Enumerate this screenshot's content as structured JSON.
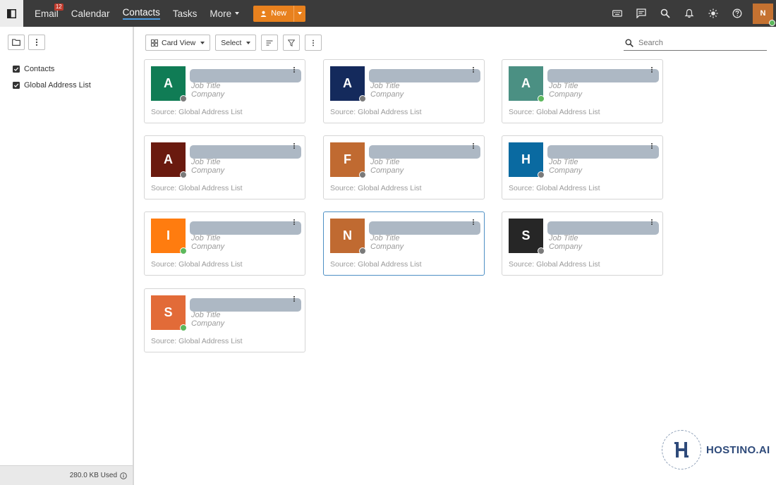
{
  "nav": {
    "items": [
      {
        "label": "Email",
        "badge": "12"
      },
      {
        "label": "Calendar"
      },
      {
        "label": "Contacts",
        "active": true
      },
      {
        "label": "Tasks"
      },
      {
        "label": "More"
      }
    ],
    "new_label": "New"
  },
  "user": {
    "initial": "N",
    "status": "online"
  },
  "folders": [
    {
      "label": "Contacts",
      "checked": true
    },
    {
      "label": "Global Address List",
      "checked": true
    }
  ],
  "quota": {
    "label": "280.0 KB Used"
  },
  "toolbar": {
    "view_label": "Card View",
    "select_label": "Select"
  },
  "search": {
    "placeholder": "Search"
  },
  "cards": [
    {
      "initial": "A",
      "color": "#107c55",
      "presence": "off",
      "job": "Job Title",
      "company": "Company",
      "source": "Source: Global Address List"
    },
    {
      "initial": "A",
      "color": "#142a5c",
      "presence": "off",
      "job": "Job Title",
      "company": "Company",
      "source": "Source: Global Address List"
    },
    {
      "initial": "A",
      "color": "#4b9083",
      "presence": "on",
      "job": "Job Title",
      "company": "Company",
      "source": "Source: Global Address List"
    },
    {
      "initial": "A",
      "color": "#6a1a0f",
      "presence": "off",
      "job": "Job Title",
      "company": "Company",
      "source": "Source: Global Address List"
    },
    {
      "initial": "F",
      "color": "#c06a31",
      "presence": "off",
      "job": "Job Title",
      "company": "Company",
      "source": "Source: Global Address List"
    },
    {
      "initial": "H",
      "color": "#0a6aa1",
      "presence": "off",
      "job": "Job Title",
      "company": "Company",
      "source": "Source: Global Address List"
    },
    {
      "initial": "I",
      "color": "#ff7c0f",
      "presence": "on",
      "job": "Job Title",
      "company": "Company",
      "source": "Source: Global Address List"
    },
    {
      "initial": "N",
      "color": "#c06a31",
      "presence": "off",
      "job": "Job Title",
      "company": "Company",
      "source": "Source: Global Address List",
      "selected": true
    },
    {
      "initial": "S",
      "color": "#262626",
      "presence": "off",
      "job": "Job Title",
      "company": "Company",
      "source": "Source: Global Address List"
    },
    {
      "initial": "S",
      "color": "#e26b38",
      "presence": "on",
      "job": "Job Title",
      "company": "Company",
      "source": "Source: Global Address List"
    }
  ],
  "logo": {
    "text": "HOSTINO.AI"
  }
}
